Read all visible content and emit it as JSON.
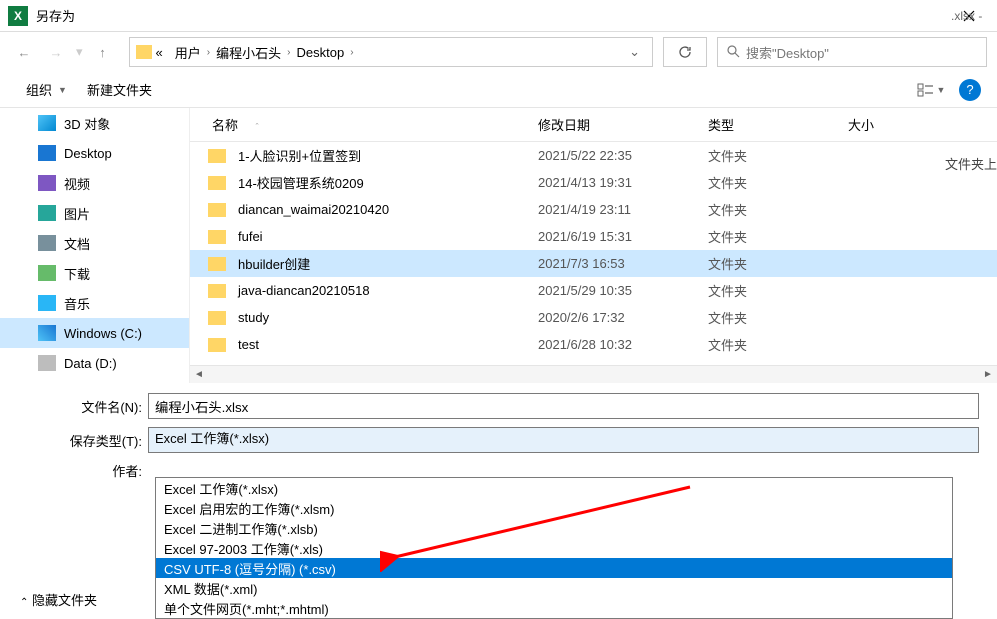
{
  "title": "另存为",
  "right_file_text": ".xlsx  -",
  "side_text": "文件夹上",
  "breadcrumb": {
    "items": [
      "用户",
      "编程小石头",
      "Desktop"
    ],
    "sep": "›"
  },
  "search": {
    "placeholder": "搜索\"Desktop\""
  },
  "toolbar": {
    "organize": "组织",
    "new_folder": "新建文件夹"
  },
  "sidebar": {
    "items": [
      {
        "label": "3D 对象",
        "icon": "blue3d"
      },
      {
        "label": "Desktop",
        "icon": "desktop"
      },
      {
        "label": "视频",
        "icon": "video"
      },
      {
        "label": "图片",
        "icon": "pic"
      },
      {
        "label": "文档",
        "icon": "doc"
      },
      {
        "label": "下载",
        "icon": "down"
      },
      {
        "label": "音乐",
        "icon": "music"
      },
      {
        "label": "Windows (C:)",
        "icon": "win",
        "selected": true
      },
      {
        "label": "Data (D:)",
        "icon": "data"
      }
    ]
  },
  "columns": {
    "name": "名称",
    "date": "修改日期",
    "type": "类型",
    "size": "大小"
  },
  "files": [
    {
      "name": "1-人脸识别+位置签到",
      "date": "2021/5/22 22:35",
      "type": "文件夹"
    },
    {
      "name": "14-校园管理系统0209",
      "date": "2021/4/13 19:31",
      "type": "文件夹"
    },
    {
      "name": "diancan_waimai20210420",
      "date": "2021/4/19 23:11",
      "type": "文件夹"
    },
    {
      "name": "fufei",
      "date": "2021/6/19 15:31",
      "type": "文件夹"
    },
    {
      "name": "hbuilder创建",
      "date": "2021/7/3 16:53",
      "type": "文件夹",
      "selected": true
    },
    {
      "name": "java-diancan20210518",
      "date": "2021/5/29 10:35",
      "type": "文件夹"
    },
    {
      "name": "study",
      "date": "2020/2/6 17:32",
      "type": "文件夹"
    },
    {
      "name": "test",
      "date": "2021/6/28 10:32",
      "type": "文件夹"
    }
  ],
  "filename_label": "文件名(N):",
  "filename_value": "编程小石头.xlsx",
  "savetype_label": "保存类型(T):",
  "savetype_value": "Excel 工作簿(*.xlsx)",
  "author_label": "作者:",
  "dropdown": [
    {
      "label": "Excel 工作簿(*.xlsx)"
    },
    {
      "label": "Excel 启用宏的工作簿(*.xlsm)"
    },
    {
      "label": "Excel 二进制工作簿(*.xlsb)"
    },
    {
      "label": "Excel 97-2003 工作簿(*.xls)"
    },
    {
      "label": "CSV UTF-8 (逗号分隔) (*.csv)",
      "hl": true
    },
    {
      "label": "XML 数据(*.xml)"
    },
    {
      "label": "单个文件网页(*.mht;*.mhtml)"
    }
  ],
  "hide_folders": "隐藏文件夹",
  "help": "?"
}
